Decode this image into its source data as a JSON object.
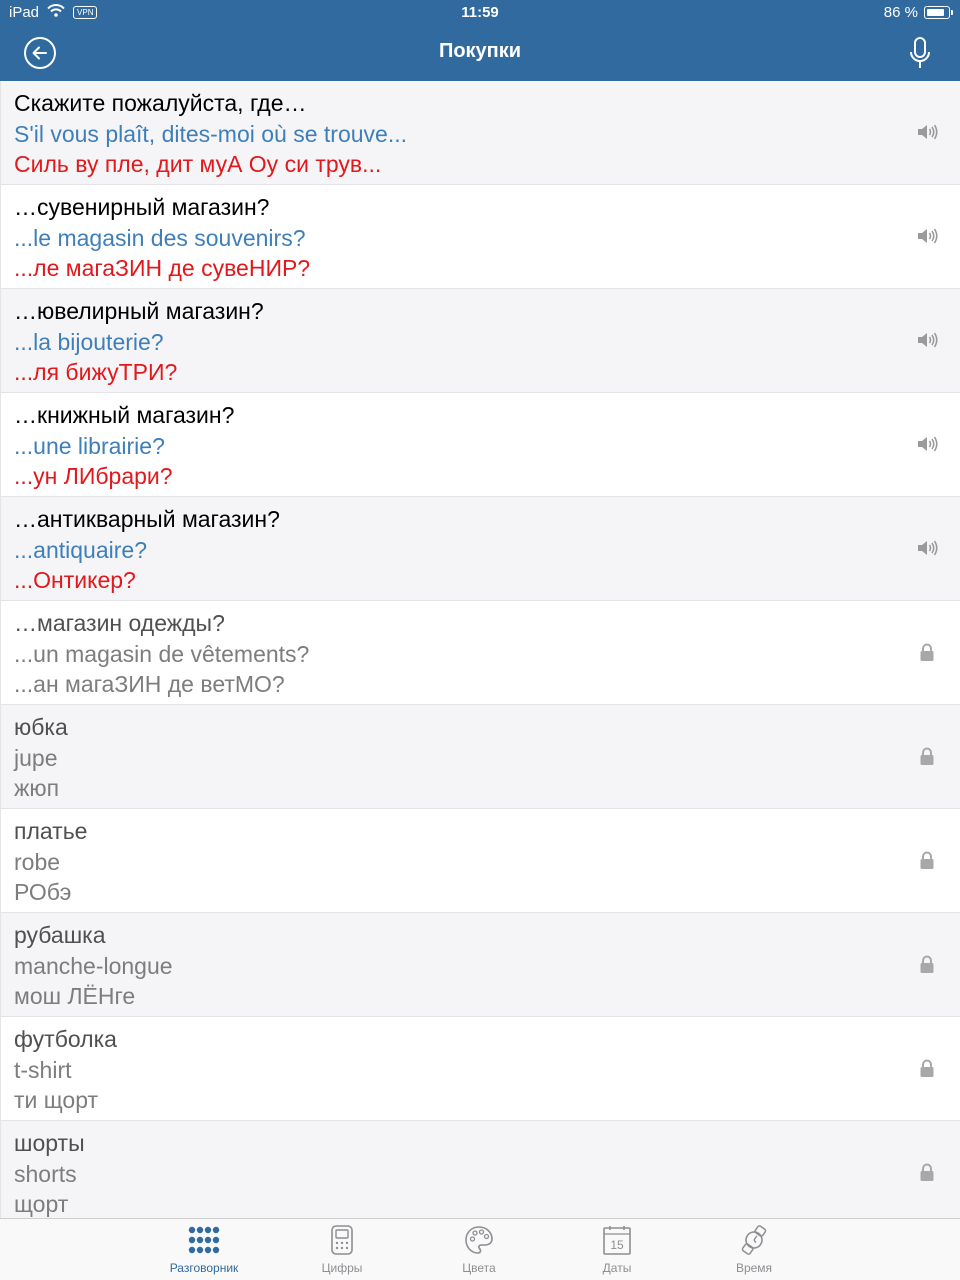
{
  "status_bar": {
    "device": "iPad",
    "vpn": "VPN",
    "time": "11:59",
    "battery": "86 %"
  },
  "nav": {
    "title": "Покупки",
    "back_icon": "back-arrow-icon",
    "mic_icon": "microphone-icon"
  },
  "colors": {
    "nav_bg": "#306a9e",
    "russian": "#000000",
    "french": "#3f7fb9",
    "transcription": "#e3181c",
    "locked_text": "#7d7d7d",
    "tab_active": "#306a9e"
  },
  "phrases": [
    {
      "ru": "Скажите пожалуйста, где…",
      "fr": "S'il vous plaît, dites-moi où se trouve...",
      "tr": "Силь ву пле, дит муА Оу си трув...",
      "locked": false,
      "icon": "speaker-icon"
    },
    {
      "ru": "…сувенирный магазин?",
      "fr": "...le magasin des souvenirs?",
      "tr": "...ле магаЗИН де сувеНИР?",
      "locked": false,
      "icon": "speaker-icon"
    },
    {
      "ru": "…ювелирный магазин?",
      "fr": "...la bijouterie?",
      "tr": "...ля бижуТРИ?",
      "locked": false,
      "icon": "speaker-icon"
    },
    {
      "ru": "…книжный магазин?",
      "fr": "...une librairie?",
      "tr": "...ун ЛИбрари?",
      "locked": false,
      "icon": "speaker-icon"
    },
    {
      "ru": "…антикварный магазин?",
      "fr": "...antiquaire?",
      "tr": "...Онтикер?",
      "locked": false,
      "icon": "speaker-icon"
    },
    {
      "ru": "…магазин одежды?",
      "fr": "...un magasin de vêtements?",
      "tr": "...ан магаЗИН де ветМО?",
      "locked": true,
      "icon": "lock-icon"
    },
    {
      "ru": "юбка",
      "fr": "jupe",
      "tr": "жюп",
      "locked": true,
      "icon": "lock-icon"
    },
    {
      "ru": "платье",
      "fr": "robe",
      "tr": "РОбэ",
      "locked": true,
      "icon": "lock-icon"
    },
    {
      "ru": "рубашка",
      "fr": "manche-longue",
      "tr": "мош ЛЁНге",
      "locked": true,
      "icon": "lock-icon"
    },
    {
      "ru": "футболка",
      "fr": "t-shirt",
      "tr": "ти щорт",
      "locked": true,
      "icon": "lock-icon"
    },
    {
      "ru": "шорты",
      "fr": "shorts",
      "tr": "щорт",
      "locked": true,
      "icon": "lock-icon"
    }
  ],
  "tabs": [
    {
      "label": "Разговорник",
      "icon": "grid-dots-icon",
      "active": true
    },
    {
      "label": "Цифры",
      "icon": "calculator-icon",
      "active": false
    },
    {
      "label": "Цвета",
      "icon": "palette-icon",
      "active": false
    },
    {
      "label": "Даты",
      "icon": "calendar-icon",
      "active": false,
      "calendar_day": "15"
    },
    {
      "label": "Время",
      "icon": "watch-icon",
      "active": false
    }
  ]
}
